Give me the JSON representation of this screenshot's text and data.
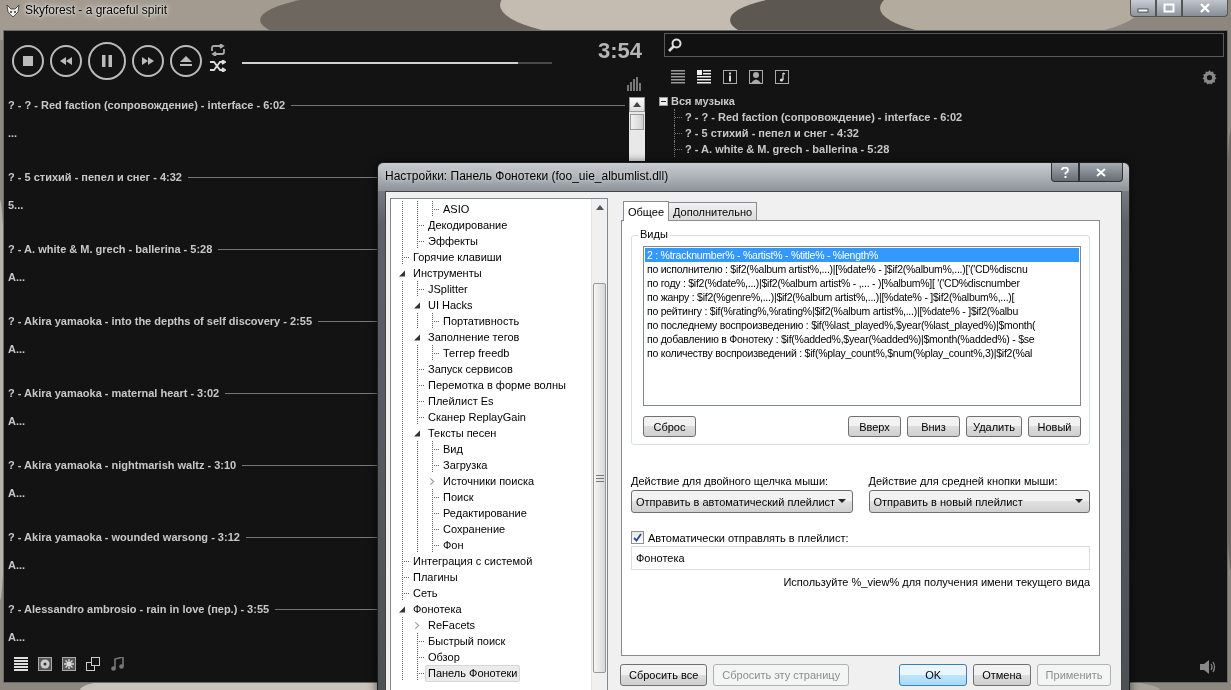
{
  "window": {
    "title": "Skyforest - a graceful spirit"
  },
  "player": {
    "time": "3:54",
    "seek": {
      "level": 0.89
    }
  },
  "playlist": [
    {
      "header": "? - ? - Red faction (сопровождение) - interface - 6:02",
      "detail": "..."
    },
    {
      "header": "? - 5 стихий - пепел и снег - 4:32",
      "detail": "5..."
    },
    {
      "header": "? - A. white & M. grech - ballerina - 5:28",
      "detail": "A..."
    },
    {
      "header": "? - Akira yamaoka - into the depths of self discovery - 2:55",
      "detail": "A..."
    },
    {
      "header": "? - Akira yamaoka - maternal heart - 3:02",
      "detail": "A..."
    },
    {
      "header": "? - Akira yamaoka - nightmarish waltz - 3:10",
      "detail": "A..."
    },
    {
      "header": "? - Akira yamaoka - wounded warsong - 3:12",
      "detail": "A..."
    },
    {
      "header": "? - Alessandro ambrosio - rain in love (пер.) - 3:55",
      "detail": "A..."
    }
  ],
  "library": {
    "tree": {
      "label": "Вся музыка",
      "expanded": true,
      "children": [
        {
          "label": "? - ? - Red faction (сопровождение) - interface - 6:02"
        },
        {
          "label": "? - 5 стихий - пепел и снег - 4:32"
        },
        {
          "label": "? - A. white & M. grech - ballerina - 5:28"
        }
      ]
    }
  },
  "dialog": {
    "title": "Настройки: Панель Фонотеки (foo_uie_albumlist.dll)",
    "tree": [
      {
        "children": [
          {
            "children": [
              {
                "label": "ASIO",
                "selected": false
              }
            ]
          },
          {
            "label": "Декодирование",
            "selected": false
          },
          {
            "label": "Эффекты",
            "selected": false
          }
        ]
      },
      {
        "label": "Горячие клавиши",
        "selected": false
      },
      {
        "label": "Инструменты",
        "selected": false,
        "expanded": true,
        "children": [
          {
            "label": "JSplitter",
            "selected": false
          },
          {
            "label": "UI Hacks",
            "selected": false,
            "expanded": true,
            "children": [
              {
                "label": "Портативность",
                "selected": false
              }
            ]
          },
          {
            "label": "Заполнение тегов",
            "selected": false,
            "expanded": true,
            "children": [
              {
                "label": "Теггер freedb",
                "selected": false
              }
            ]
          },
          {
            "label": "Запуск сервисов",
            "selected": false
          },
          {
            "label": "Перемотка в форме волны",
            "selected": false
          },
          {
            "label": "Плейлист Es",
            "selected": false
          },
          {
            "label": "Сканер ReplayGain",
            "selected": false
          },
          {
            "label": "Тексты песен",
            "selected": false,
            "expanded": true,
            "children": [
              {
                "label": "Вид",
                "selected": false
              },
              {
                "label": "Загрузка",
                "selected": false
              },
              {
                "label": "Источники поиска",
                "selected": false,
                "expanded": false
              },
              {
                "label": "Поиск",
                "selected": false
              },
              {
                "label": "Редактирование",
                "selected": false
              },
              {
                "label": "Сохранение",
                "selected": false
              },
              {
                "label": "Фон",
                "selected": false
              }
            ]
          }
        ]
      },
      {
        "label": "Интеграция с системой",
        "selected": false
      },
      {
        "label": "Плагины",
        "selected": false
      },
      {
        "label": "Сеть",
        "selected": false
      },
      {
        "label": "Фонотека",
        "selected": false,
        "expanded": true,
        "children": [
          {
            "label": "ReFacets",
            "selected": false,
            "expanded": false
          },
          {
            "label": "Быстрый поиск",
            "selected": false
          },
          {
            "label": "Обзор",
            "selected": false
          },
          {
            "label": "Панель Фонотеки",
            "selected": true
          }
        ]
      }
    ],
    "tabs": [
      {
        "label": "Общее",
        "selected": true
      },
      {
        "label": "Дополнительно",
        "selected": false
      }
    ],
    "views": {
      "label": "Виды",
      "items": [
        {
          "text": "2 : %tracknumber% - %artist% - %title% - %length%",
          "selected": true
        },
        {
          "text": "по исполнителю : $if2(%album artist%,...)|[%date% - ]$if2(%album%,...)['('CD%discnu",
          "selected": false
        },
        {
          "text": "по году : $if2(%date%,...)|$if2(%album artist% - ,... - )[%album%][ '('CD%discnumber",
          "selected": false
        },
        {
          "text": "по жанру : $if2(%genre%,...)|$if2(%album artist%,...)|[%date% - ]$if2(%album%,...)[",
          "selected": false
        },
        {
          "text": "по рейтингу : $if(%rating%,%rating%|$if2(%album artist%,...)|[%date% - ]$if2(%albu",
          "selected": false
        },
        {
          "text": "по последнему воспроизведению : $if(%last_played%,$year(%last_played%)|$month(",
          "selected": false
        },
        {
          "text": "по добавлению в Фонотеку : $if(%added%,$year(%added%)|$month(%added%) - $se",
          "selected": false
        },
        {
          "text": "по количеству воспроизведений : $if(%play_count%,$num(%play_count%,3)|$if2(%al",
          "selected": false
        }
      ],
      "buttons": [
        "Сброс",
        "Вверх",
        "Вниз",
        "Удалить",
        "Новый"
      ]
    },
    "double_click": {
      "label": "Действие для двойного щелчка мыши:",
      "value": "Отправить в автоматический плейлист"
    },
    "middle_click": {
      "label": "Действие для средней кнопки мыши:",
      "value": "Отправить в новый плейлист"
    },
    "auto_send": {
      "label": "Автоматически отправлять в плейлист:",
      "checked": true
    },
    "playlist_name": {
      "value": "Фонотека"
    },
    "hint": "Используйте %_view% для получения имени текущего вида",
    "buttons": [
      {
        "label": "Сбросить все",
        "disabled": false,
        "default": false
      },
      {
        "label": "Сбросить эту страницу",
        "disabled": true,
        "default": false
      },
      {
        "label": "OK",
        "disabled": false,
        "default": true
      },
      {
        "label": "Отмена",
        "disabled": false,
        "default": false
      },
      {
        "label": "Применить",
        "disabled": true,
        "default": false
      }
    ]
  }
}
